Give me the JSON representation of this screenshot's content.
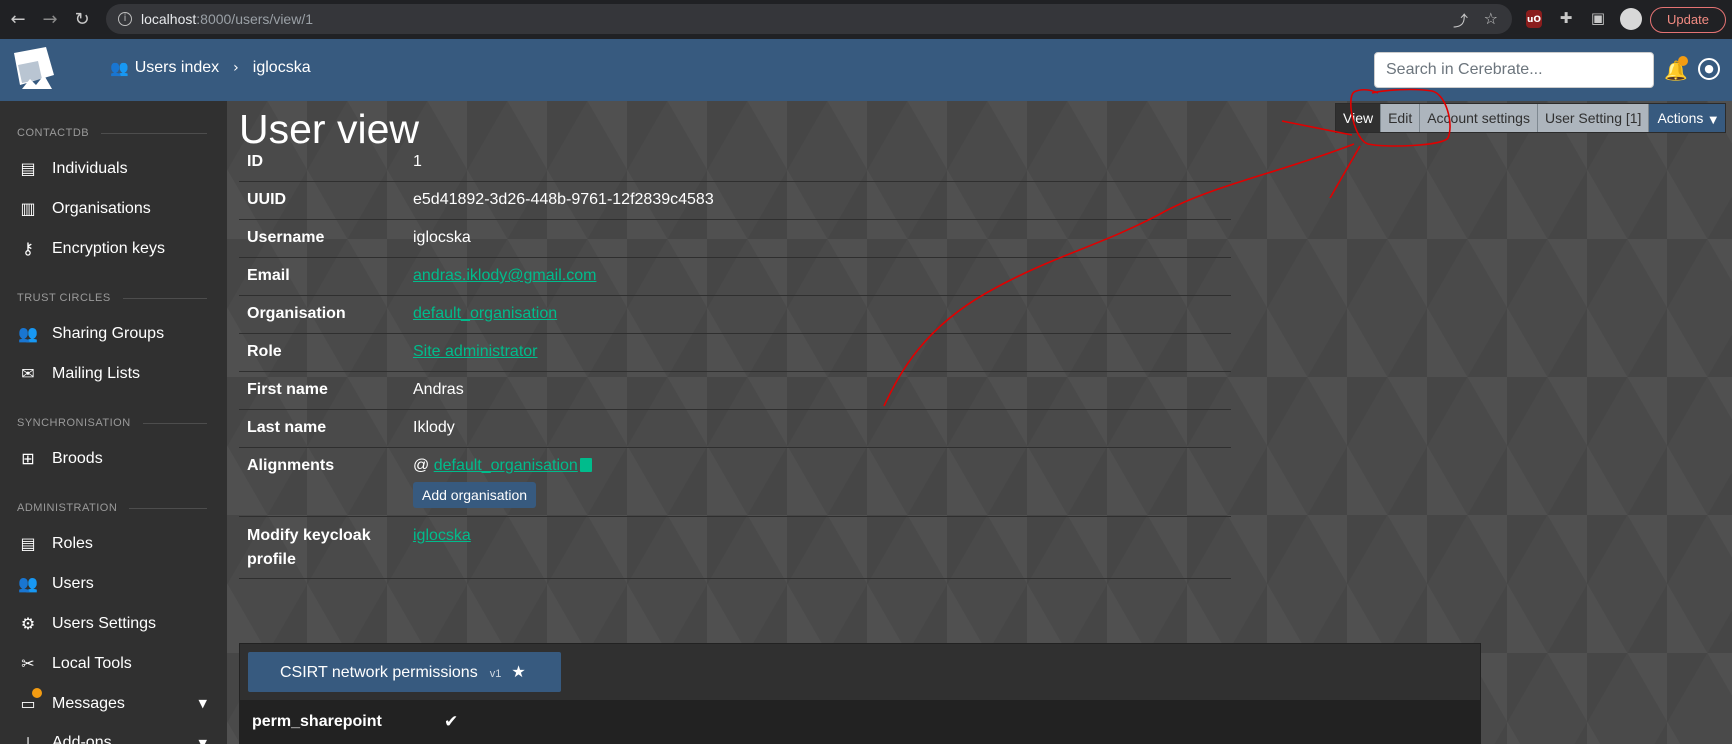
{
  "browser": {
    "url_host": "localhost",
    "url_rest": ":8000/users/view/1",
    "update_label": "Update"
  },
  "header": {
    "breadcrumb": [
      "Users index",
      "iglocska"
    ],
    "search_placeholder": "Search in Cerebrate..."
  },
  "sidebar": {
    "sections": [
      {
        "heading": "CONTACTDB",
        "items": [
          {
            "label": "Individuals",
            "icon": "address-card-icon"
          },
          {
            "label": "Organisations",
            "icon": "building-icon"
          },
          {
            "label": "Encryption keys",
            "icon": "key-icon"
          }
        ]
      },
      {
        "heading": "TRUST CIRCLES",
        "items": [
          {
            "label": "Sharing Groups",
            "icon": "users-icon"
          },
          {
            "label": "Mailing Lists",
            "icon": "mail-bulk-icon"
          }
        ]
      },
      {
        "heading": "SYNCHRONISATION",
        "items": [
          {
            "label": "Broods",
            "icon": "network-icon"
          }
        ]
      },
      {
        "heading": "ADMINISTRATION",
        "items": [
          {
            "label": "Roles",
            "icon": "id-badge-icon"
          },
          {
            "label": "Users",
            "icon": "users-icon"
          },
          {
            "label": "Users Settings",
            "icon": "user-cog-icon"
          },
          {
            "label": "Local Tools",
            "icon": "tools-icon"
          },
          {
            "label": "Messages",
            "icon": "inbox-icon"
          },
          {
            "label": "Add-ons",
            "icon": "plug-icon"
          }
        ]
      }
    ]
  },
  "page": {
    "title": "User view",
    "actions": {
      "view": "View",
      "edit": "Edit",
      "account_settings": "Account settings",
      "user_setting": "User Setting [1]",
      "actions": "Actions"
    },
    "fields": [
      {
        "key": "ID",
        "value": "1"
      },
      {
        "key": "UUID",
        "value": "e5d41892-3d26-448b-9761-12f2839c4583"
      },
      {
        "key": "Username",
        "value": "iglocska"
      },
      {
        "key": "Email",
        "value": "andras.iklody@gmail.com"
      },
      {
        "key": "Organisation",
        "value": "default_organisation"
      },
      {
        "key": "Role",
        "value": "Site administrator"
      },
      {
        "key": "First name",
        "value": "Andras"
      },
      {
        "key": "Last name",
        "value": "Iklody"
      },
      {
        "key": "Alignments",
        "value": "default_organisation",
        "prefix": "@",
        "button": "Add organisation"
      },
      {
        "key": "Modify keycloak profile",
        "value": "iglocska"
      }
    ],
    "meta_template": {
      "name": "CSIRT network permissions",
      "version": "v1",
      "rows": [
        {
          "key": "perm_sharepoint"
        }
      ]
    }
  }
}
